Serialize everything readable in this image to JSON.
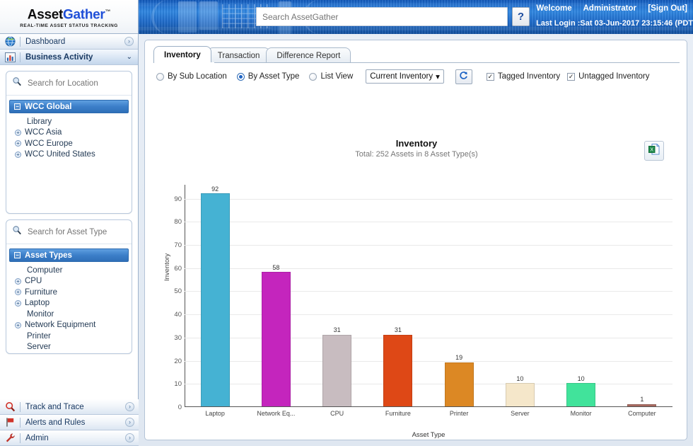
{
  "brand": {
    "name_part1": "Asset",
    "name_part2": "Gather",
    "tm": "™",
    "tagline": "REAL-TIME ASSET STATUS TRACKING"
  },
  "header": {
    "search_placeholder": "Search AssetGather",
    "help_label": "?",
    "welcome_text": "Welcome",
    "user_name": "Administrator",
    "sign_out": "[Sign Out]",
    "last_login": "Last Login :Sat 03-Jun-2017 23:15:46 (PDT"
  },
  "sidebar": {
    "nav_top": [
      {
        "label": "Dashboard",
        "icon": "globe-icon",
        "arrow": "›",
        "active": false
      },
      {
        "label": "Business Activity",
        "icon": "bar-chart-icon",
        "arrow": "⌄",
        "active": true
      }
    ],
    "location_panel": {
      "search_placeholder": "Search for Location",
      "root_label": "WCC Global",
      "root_toggle": "−",
      "items": [
        {
          "label": "Library",
          "expandable": false
        },
        {
          "label": "WCC Asia",
          "expandable": true
        },
        {
          "label": "WCC Europe",
          "expandable": true
        },
        {
          "label": "WCC United States",
          "expandable": true
        }
      ]
    },
    "asset_panel": {
      "search_placeholder": "Search for Asset Type",
      "root_label": "Asset Types",
      "root_toggle": "−",
      "items": [
        {
          "label": "Computer",
          "expandable": false
        },
        {
          "label": "CPU",
          "expandable": true
        },
        {
          "label": "Furniture",
          "expandable": true
        },
        {
          "label": "Laptop",
          "expandable": true
        },
        {
          "label": "Monitor",
          "expandable": false
        },
        {
          "label": "Network Equipment",
          "expandable": true
        },
        {
          "label": "Printer",
          "expandable": false
        },
        {
          "label": "Server",
          "expandable": false
        }
      ]
    },
    "nav_bottom": [
      {
        "label": "Track and Trace",
        "icon": "magnifier-icon",
        "arrow": "›"
      },
      {
        "label": "Alerts and Rules",
        "icon": "flag-icon",
        "arrow": "›"
      },
      {
        "label": "Admin",
        "icon": "wrench-icon",
        "arrow": "›"
      }
    ]
  },
  "main": {
    "tabs": [
      {
        "label": "Inventory",
        "active": true
      },
      {
        "label": "Transaction",
        "active": false
      },
      {
        "label": "Difference Report",
        "active": false
      }
    ],
    "controls": {
      "radios": [
        {
          "label": "By Sub Location",
          "selected": false
        },
        {
          "label": "By Asset Type",
          "selected": true
        },
        {
          "label": "List View",
          "selected": false
        }
      ],
      "select_value": "Current Inventory",
      "select_caret": "▾",
      "refresh_icon": "refresh-icon",
      "checkboxes": [
        {
          "label": "Tagged Inventory",
          "checked": true
        },
        {
          "label": "Untagged Inventory",
          "checked": true
        }
      ]
    },
    "export_icon": "excel-export-icon"
  },
  "chart_data": {
    "type": "bar",
    "title": "Inventory",
    "subtitle": "Total: 252 Assets in 8 Asset Type(s)",
    "xlabel": "Asset Type",
    "ylabel": "Inventory",
    "ylim": [
      0,
      96
    ],
    "yticks": [
      0,
      10,
      20,
      30,
      40,
      50,
      60,
      70,
      80,
      90
    ],
    "grid": true,
    "legend": "none",
    "categories": [
      "Laptop",
      "Network Eq...",
      "CPU",
      "Furniture",
      "Printer",
      "Server",
      "Monitor",
      "Computer"
    ],
    "values": [
      92,
      58,
      31,
      31,
      19,
      10,
      10,
      1
    ],
    "colors": [
      "#45b2d3",
      "#c425bd",
      "#c8bcc0",
      "#de4816",
      "#dc8824",
      "#f5e7ca",
      "#41e39b",
      "#a86a60"
    ]
  }
}
